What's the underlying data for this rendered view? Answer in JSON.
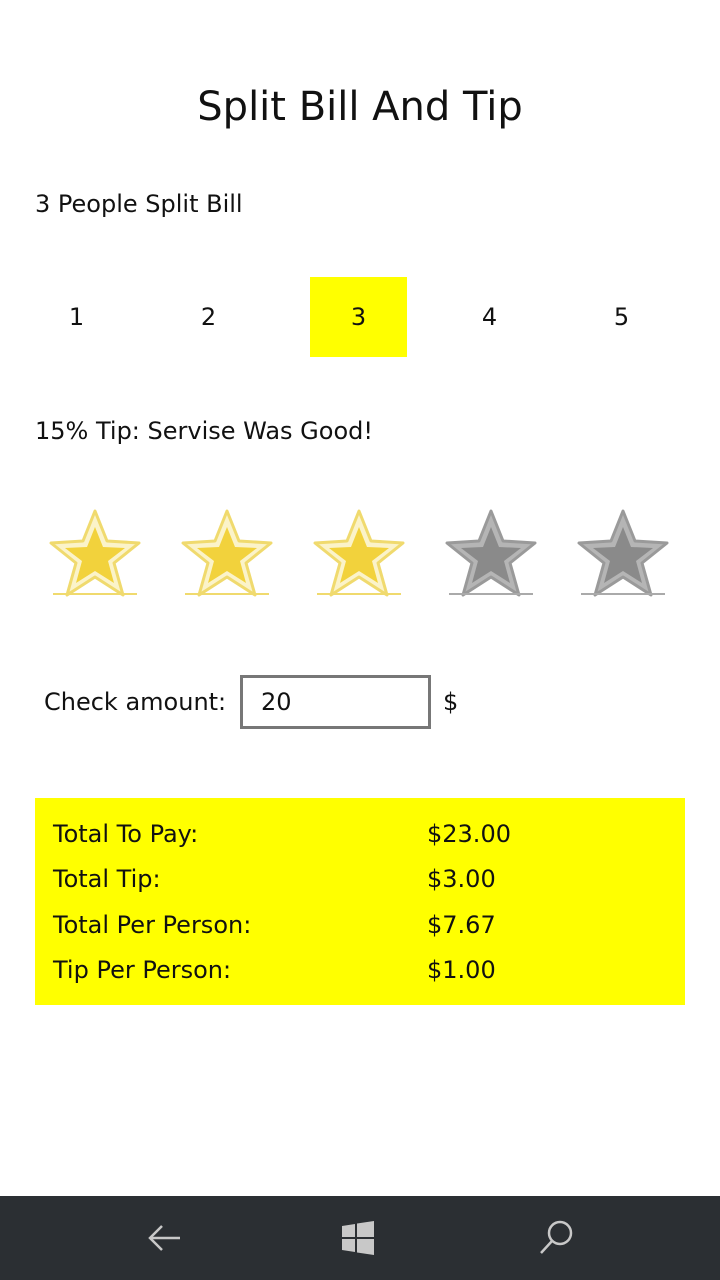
{
  "title": "Split Bill And Tip",
  "people": {
    "label": "3 People Split Bill",
    "options": [
      "1",
      "2",
      "3",
      "4",
      "5"
    ],
    "selected": "3"
  },
  "tip": {
    "label": "15% Tip: Servise Was Good!",
    "rating": 3,
    "max_rating": 5,
    "active_color": "#f2d23c",
    "inactive_color": "#8a8a8a"
  },
  "check": {
    "label": "Check amount:",
    "value": "20",
    "currency": "$"
  },
  "summary": {
    "background": "#ffff00",
    "rows": [
      {
        "label": "Total To Pay:",
        "value": "$23.00"
      },
      {
        "label": "Total Tip:",
        "value": "$3.00"
      },
      {
        "label": "Total Per Person:",
        "value": "$7.67"
      },
      {
        "label": "Tip Per Person:",
        "value": "$1.00"
      }
    ]
  },
  "navbar": {
    "icons": [
      "back-arrow-icon",
      "windows-logo-icon",
      "search-icon"
    ]
  }
}
